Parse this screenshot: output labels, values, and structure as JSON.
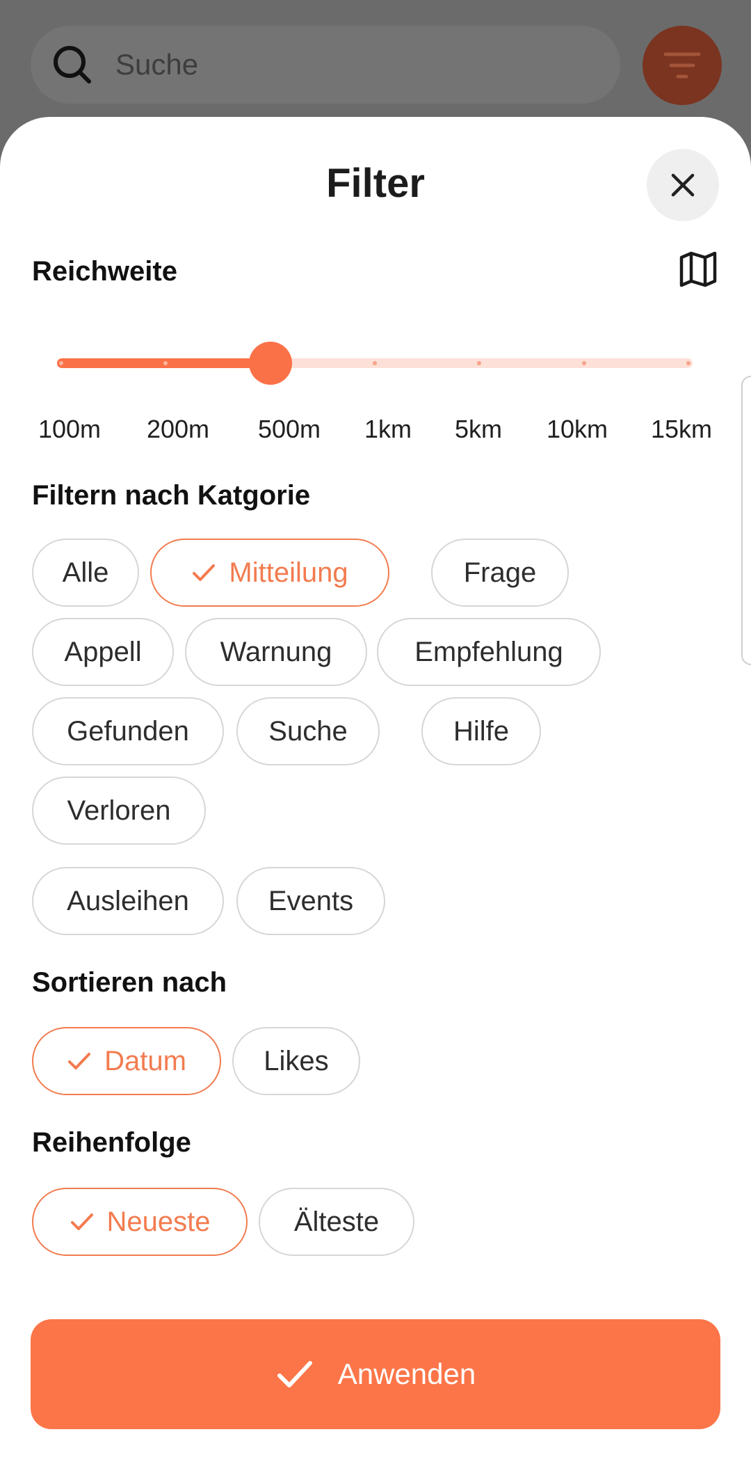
{
  "search": {
    "placeholder": "Suche",
    "icon": "search-icon"
  },
  "filter_button": {
    "icon": "filter-icon",
    "color": "#7a3420"
  },
  "sheet": {
    "title": "Filter",
    "close_icon": "close-icon"
  },
  "range": {
    "label": "Reichweite",
    "map_icon": "map-icon",
    "stops": [
      "100m",
      "200m",
      "500m",
      "1km",
      "5km",
      "10km",
      "15km"
    ],
    "selected_index": 2,
    "selected_value": "500m"
  },
  "category": {
    "label": "Filtern nach Katgorie",
    "chips": [
      {
        "label": "Alle",
        "selected": false
      },
      {
        "label": "Mitteilung",
        "selected": true
      },
      {
        "label": "Frage",
        "selected": false
      },
      {
        "label": "Appell",
        "selected": false
      },
      {
        "label": "Warnung",
        "selected": false
      },
      {
        "label": "Empfehlung",
        "selected": false
      },
      {
        "label": "Gefunden",
        "selected": false
      },
      {
        "label": "Suche",
        "selected": false
      },
      {
        "label": "Hilfe",
        "selected": false
      },
      {
        "label": "Verloren",
        "selected": false
      },
      {
        "label": "Ausleihen",
        "selected": false
      },
      {
        "label": "Events",
        "selected": false
      }
    ]
  },
  "sort": {
    "label": "Sortieren nach",
    "chips": [
      {
        "label": "Datum",
        "selected": true
      },
      {
        "label": "Likes",
        "selected": false
      }
    ]
  },
  "order": {
    "label": "Reihenfolge",
    "chips": [
      {
        "label": "Neueste",
        "selected": true
      },
      {
        "label": "Älteste",
        "selected": false
      }
    ]
  },
  "apply": {
    "label": "Anwenden",
    "icon": "check-icon"
  },
  "colors": {
    "accent": "#fb7548",
    "accent_light": "#fde0d7",
    "chip_border": "#d6d6d6"
  }
}
